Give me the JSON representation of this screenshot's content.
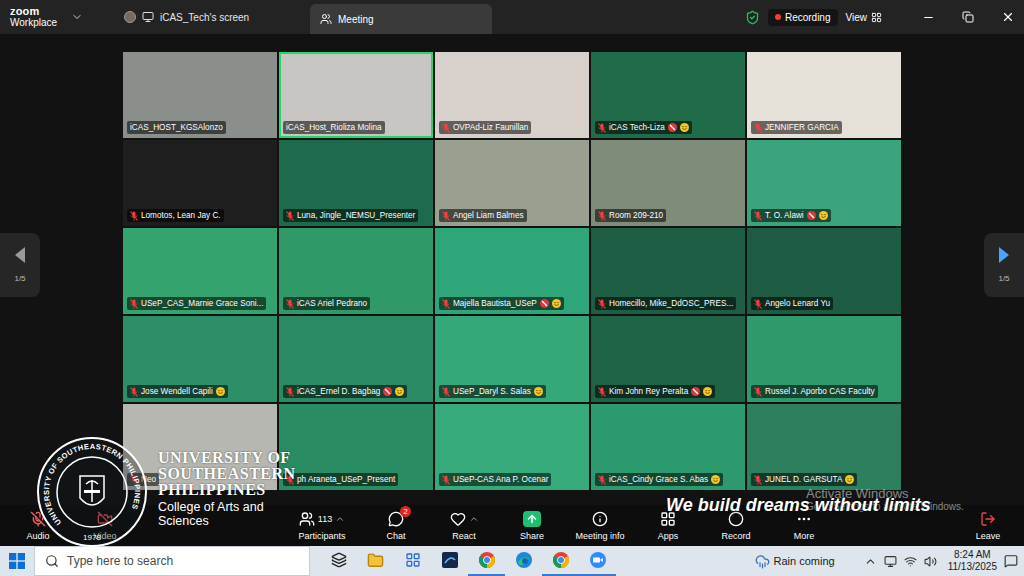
{
  "title_bar": {
    "logo": "zoom",
    "product": "Workplace",
    "shared_screen": "iCAS_Tech's screen",
    "tab": {
      "label": "Meeting",
      "selected": true
    },
    "recording": {
      "label": "Recording",
      "on": true
    },
    "view": "View"
  },
  "pager": {
    "left": {
      "label": "1/5",
      "enabled": false
    },
    "right": {
      "label": "1/5",
      "enabled": true
    }
  },
  "tiles": [
    {
      "name": "iCAS_HOST_KGSAlonzo",
      "muted": false,
      "active_speaker": false,
      "video_off": false,
      "emoji": false,
      "color": "#8b8f8c"
    },
    {
      "name": "iCAS_Host_Rioliza Molina",
      "muted": false,
      "active_speaker": true,
      "video_off": false,
      "emoji": false,
      "color": "#c9c5c2"
    },
    {
      "name": "OVPAd-Liz Faunillan",
      "muted": true,
      "active_speaker": false,
      "video_off": false,
      "emoji": false,
      "color": "#d8d1cb"
    },
    {
      "name": "iCAS Tech-Liza",
      "muted": true,
      "active_speaker": false,
      "video_off": true,
      "emoji": true,
      "color": "#1f6b4a"
    },
    {
      "name": "JENNIFER GARCIA",
      "muted": true,
      "active_speaker": false,
      "video_off": false,
      "emoji": false,
      "color": "#e6e1d8"
    },
    {
      "name": "Lomotos, Lean Jay C.",
      "muted": true,
      "active_speaker": false,
      "video_off": false,
      "emoji": false,
      "color": "#1e1e1e"
    },
    {
      "name": "Luna, Jingle_NEMSU_Presenter",
      "muted": true,
      "active_speaker": false,
      "video_off": false,
      "emoji": false,
      "color": "#1e6a4c"
    },
    {
      "name": "Angel Liam Balmes",
      "muted": true,
      "active_speaker": false,
      "video_off": false,
      "emoji": false,
      "color": "#9aa08f"
    },
    {
      "name": "Room 209-210",
      "muted": true,
      "active_speaker": false,
      "video_off": false,
      "emoji": false,
      "color": "#7f8c7a"
    },
    {
      "name": "T. O. Alawi",
      "muted": true,
      "active_speaker": false,
      "video_off": true,
      "emoji": true,
      "color": "#3aa57c"
    },
    {
      "name": "USeP_CAS_Marnie Grace Soni...",
      "muted": true,
      "active_speaker": false,
      "video_off": false,
      "emoji": false,
      "color": "#34a36e"
    },
    {
      "name": "iCAS Ariel Pedrano",
      "muted": true,
      "active_speaker": false,
      "video_off": false,
      "emoji": false,
      "color": "#2f9a68"
    },
    {
      "name": "Majella Bautista_USeP",
      "muted": true,
      "active_speaker": false,
      "video_off": true,
      "emoji": true,
      "color": "#2fa57a"
    },
    {
      "name": "Homecillo, Mike_DdOSC_PRES...",
      "muted": true,
      "active_speaker": false,
      "video_off": false,
      "emoji": false,
      "color": "#1e5e45"
    },
    {
      "name": "Angelo Lenard Yu",
      "muted": true,
      "active_speaker": false,
      "video_off": false,
      "emoji": false,
      "color": "#1d5b42"
    },
    {
      "name": "Jose Wendell Capili",
      "muted": true,
      "active_speaker": false,
      "video_off": false,
      "emoji": true,
      "color": "#2c8f68"
    },
    {
      "name": "iCAS_Ernel D. Bagbag",
      "muted": true,
      "active_speaker": false,
      "video_off": true,
      "emoji": true,
      "color": "#2a8a63"
    },
    {
      "name": "USeP_Daryl S. Salas",
      "muted": true,
      "active_speaker": false,
      "video_off": false,
      "emoji": true,
      "color": "#35a87a"
    },
    {
      "name": "Kim John Rey Peralta",
      "muted": true,
      "active_speaker": false,
      "video_off": true,
      "emoji": true,
      "color": "#1f6347"
    },
    {
      "name": "Russel J. Aporbo CAS Faculty",
      "muted": true,
      "active_speaker": false,
      "video_off": false,
      "emoji": false,
      "color": "#2e9a6c"
    },
    {
      "name": "Neo",
      "muted": true,
      "active_speaker": false,
      "video_off": false,
      "emoji": false,
      "color": "#b5b7b0"
    },
    {
      "name": "ph Araneta_USeP_Present",
      "muted": true,
      "active_speaker": false,
      "video_off": false,
      "emoji": false,
      "color": "#2a8c63"
    },
    {
      "name": "USeP-CAS Ana P. Ocenar",
      "muted": true,
      "active_speaker": false,
      "video_off": false,
      "emoji": false,
      "color": "#37aa7c"
    },
    {
      "name": "iCAS_Cindy Grace S. Abas",
      "muted": true,
      "active_speaker": false,
      "video_off": false,
      "emoji": true,
      "color": "#2c9a6e"
    },
    {
      "name": "JUNEL D. GARSUTA",
      "muted": true,
      "active_speaker": false,
      "video_off": false,
      "emoji": true,
      "color": "#2d7f5e"
    }
  ],
  "toolbar": {
    "left": [
      {
        "label": "Audio",
        "off": true
      },
      {
        "label": "Video",
        "off": true
      }
    ],
    "center": [
      {
        "label": "Participants",
        "count": "113",
        "badge": ""
      },
      {
        "label": "Chat",
        "count": "",
        "badge": "2"
      },
      {
        "label": "React",
        "count": "",
        "badge": ""
      },
      {
        "label": "Share",
        "count": "",
        "badge": ""
      },
      {
        "label": "Meeting info",
        "count": "",
        "badge": ""
      },
      {
        "label": "Apps",
        "count": "",
        "badge": ""
      },
      {
        "label": "Record",
        "count": "",
        "badge": ""
      },
      {
        "label": "More",
        "count": "",
        "badge": ""
      }
    ],
    "leave": "Leave"
  },
  "brand": {
    "seal_text": "UNIVERSITY OF SOUTHEASTERN PHILIPPINES",
    "seal_year": "1978",
    "lines": [
      "UNIVERSITY OF",
      "SOUTHEASTERN",
      "PHILIPPINES"
    ],
    "college": "College of Arts and Sciences",
    "slogan": "We build dreams without limits"
  },
  "watermark": {
    "title": "Activate Windows",
    "subtitle": "Go to Settings to activate Windows."
  },
  "taskbar": {
    "search_placeholder": "Type here to search",
    "pinned": [
      {
        "running": false
      },
      {
        "running": false
      },
      {
        "running": false
      },
      {
        "running": false
      },
      {
        "running": true
      },
      {
        "running": false
      },
      {
        "running": true
      },
      {
        "running": true
      }
    ],
    "weather": "Rain coming",
    "time": "8:24 AM",
    "date": "11/13/2025"
  }
}
